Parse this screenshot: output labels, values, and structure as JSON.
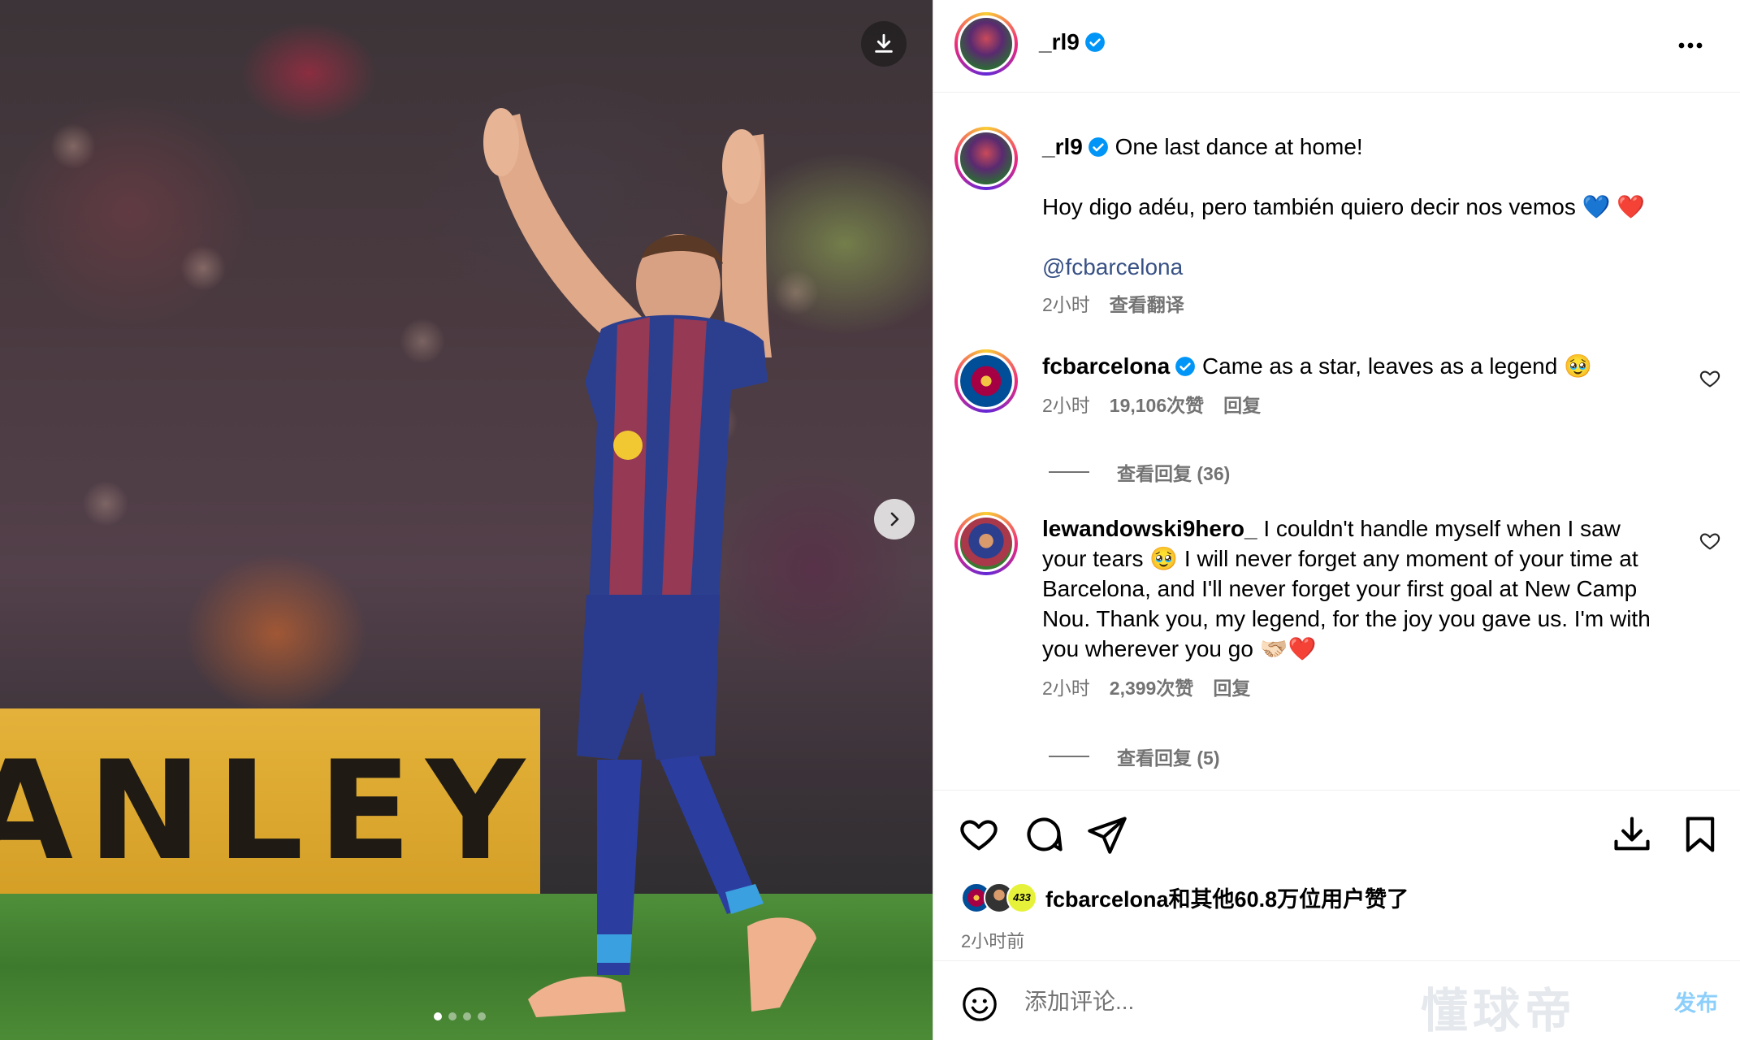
{
  "photo": {
    "banner_text": "ANLEY",
    "carousel_dots": 4,
    "carousel_active_index": 0,
    "download_icon": "download-icon",
    "next_icon": "chevron-right-icon"
  },
  "post_header": {
    "username": "_rl9",
    "verified_icon": "verified-badge-icon",
    "more_icon": "more-horizontal-icon"
  },
  "caption": {
    "username": "_rl9",
    "line1": "One last dance at home!",
    "line2": "Hoy digo adéu, pero también quiero decir nos vemos 💙 ❤️",
    "mention": "@fcbarcelona",
    "time": "2小时",
    "translate": "查看翻译"
  },
  "comments": [
    {
      "username": "fcbarcelona",
      "verified": true,
      "text": "Came as a star, leaves as a legend 🥹",
      "time": "2小时",
      "likes": "19,106次赞",
      "reply": "回复",
      "view_replies": "查看回复 (36)"
    },
    {
      "username": "lewandowski9hero_",
      "verified": false,
      "text": "I couldn't handle myself when I saw your tears 🥹 I will never forget any moment of your time at Barcelona, and I'll never forget your first goal at New Camp Nou. Thank you, my legend, for the joy you gave us. I'm with you wherever you go 🫱🏻‍🫲🏼❤️",
      "time": "2小时",
      "likes": "2,399次赞",
      "reply": "回复",
      "view_replies": "查看回复 (5)"
    }
  ],
  "actions": {
    "icons": [
      "heart-icon",
      "comment-icon",
      "share-icon",
      "download-icon",
      "bookmark-icon"
    ],
    "likes_text": "fcbarcelona和其他60.8万位用户赞了",
    "liker_badge": "433",
    "time_ago": "2小时前"
  },
  "add_comment": {
    "placeholder": "添加评论...",
    "post_label": "发布",
    "watermark": "懂球帝"
  },
  "colors": {
    "link": "#385185",
    "muted": "#737373",
    "post_button": "#0095f6",
    "verified": "#0095f6"
  }
}
